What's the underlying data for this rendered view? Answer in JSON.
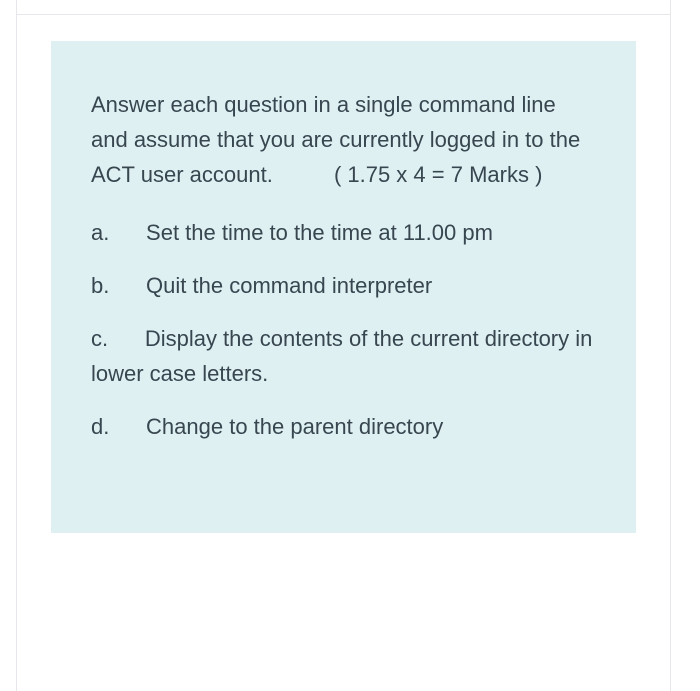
{
  "question": {
    "intro_line1": "Answer each question in a single",
    "intro_line2": "command line and assume that you",
    "intro_line3": "are currently logged in to the ACT",
    "intro_line4_a": "user account.",
    "intro_line4_gap": "          ",
    "marks": "( 1.75 x 4 = 7",
    "intro_line5": "Marks )",
    "items": [
      {
        "letter": "a.",
        "gap": "      ",
        "text": "Set the time to the time at 11.00 pm"
      },
      {
        "letter": "b.",
        "gap": "      ",
        "text": "Quit the command interpreter"
      },
      {
        "letter": "c.",
        "gap": "      ",
        "text": "Display the contents of the current directory in lower case letters."
      },
      {
        "letter": "d.",
        "gap": "      ",
        "text": "Change to the parent directory"
      }
    ]
  }
}
